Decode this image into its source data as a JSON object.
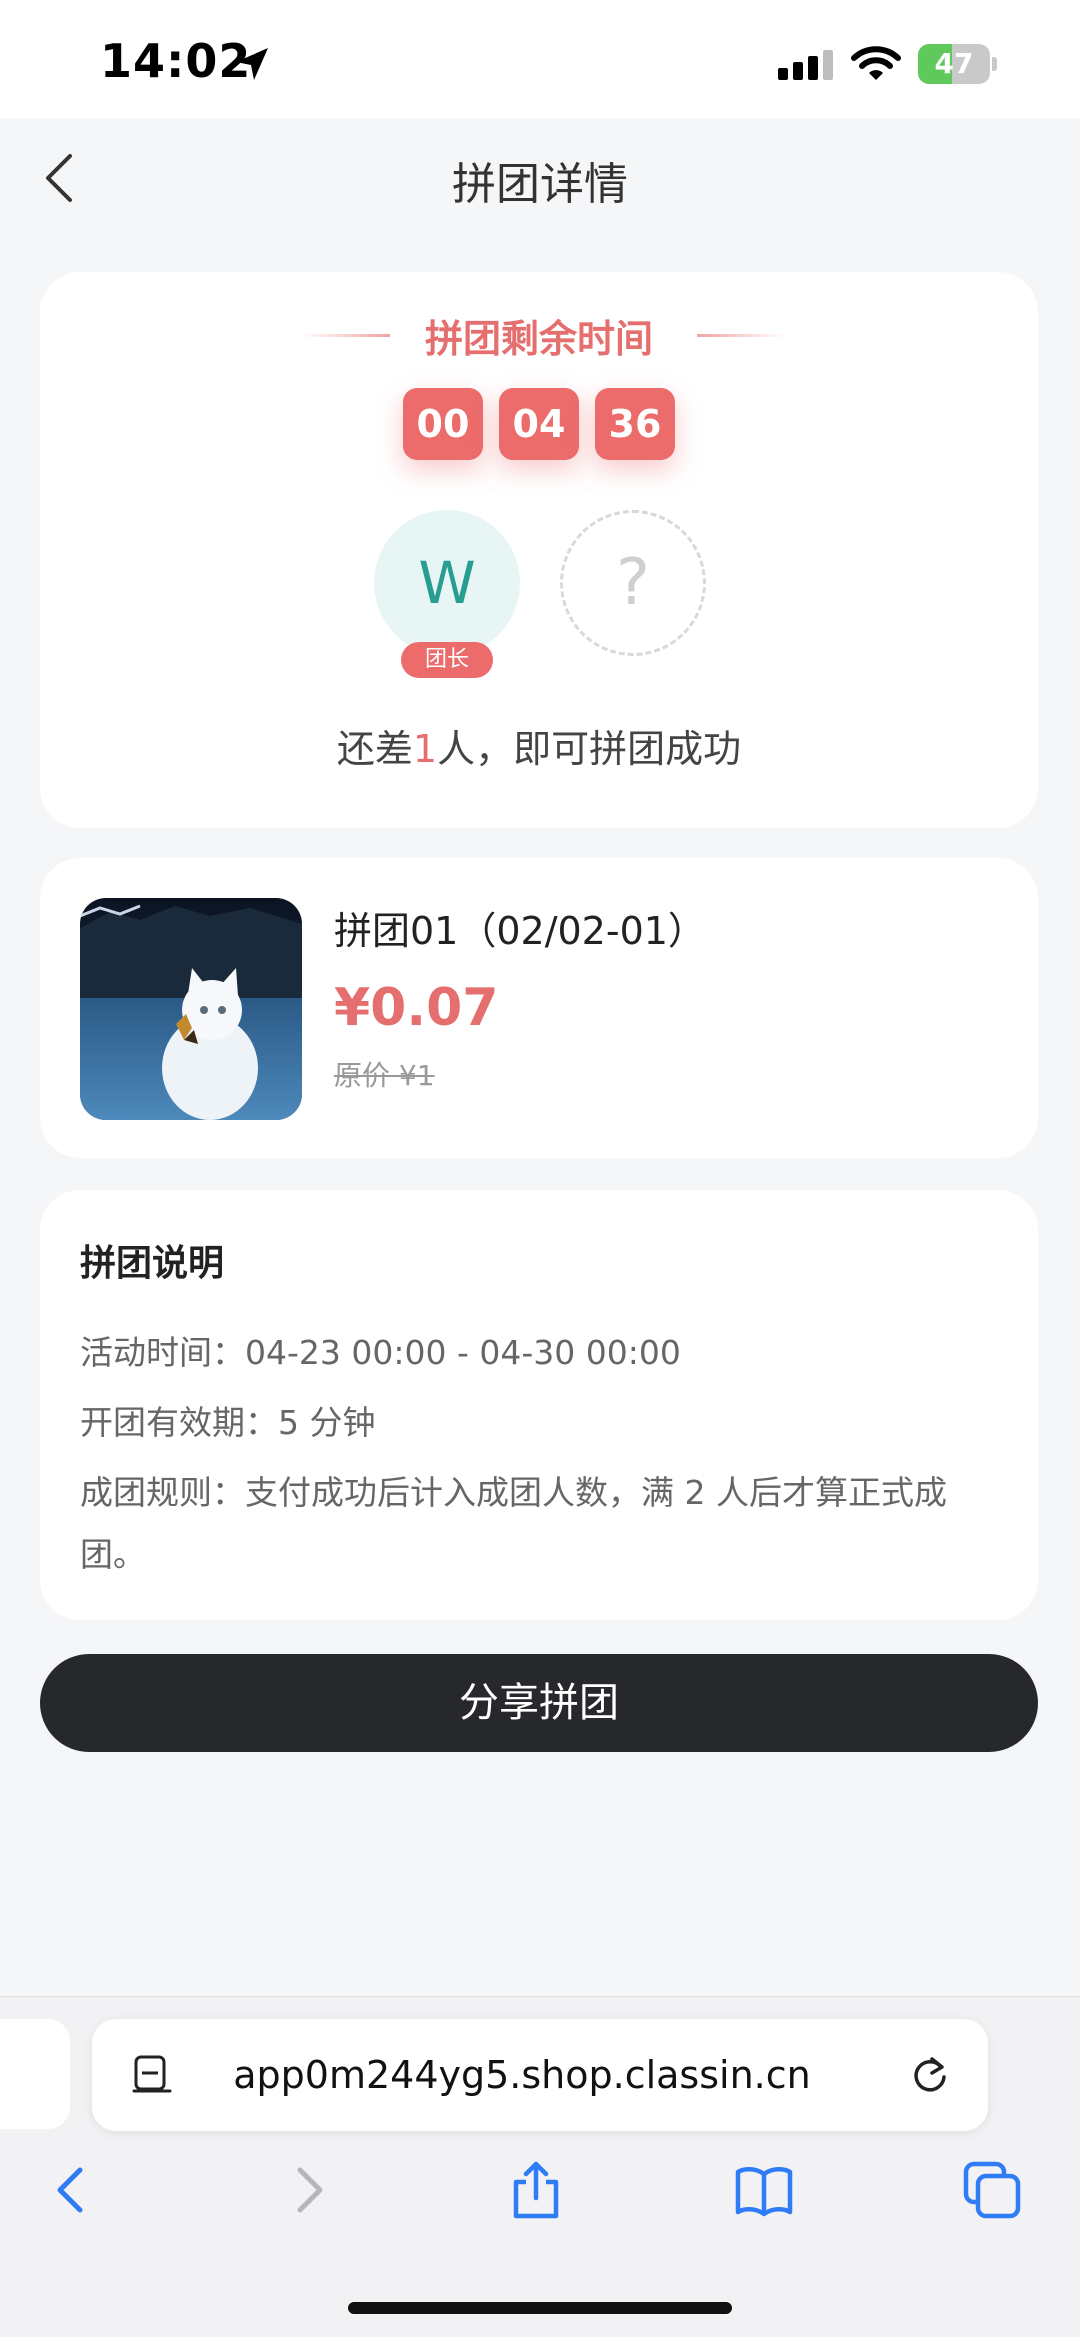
{
  "status_bar": {
    "time": "14:02",
    "battery_percent": 47,
    "battery_label": "47",
    "icons": [
      "location-arrow-icon",
      "cellular-signal-icon",
      "wifi-icon",
      "battery-charging-icon"
    ]
  },
  "nav": {
    "title": "拼团详情",
    "back_icon": "chevron-left-icon"
  },
  "countdown": {
    "title": "拼团剩余时间",
    "hours": "00",
    "minutes": "04",
    "seconds": "36",
    "leader_initial": "W",
    "leader_badge": "团长",
    "empty_slot": "?",
    "status_prefix": "还差",
    "status_count": "1",
    "status_suffix": "人，即可拼团成功"
  },
  "product": {
    "name": "拼团01（02/02-01）",
    "price": "¥0.07",
    "original_price": "原价 ¥1",
    "thumb_icon": "white-kitten-photo"
  },
  "rules": {
    "title": "拼团说明",
    "activity_time": "活动时间：04-23 00:00 - 04-30 00:00",
    "validity": "开团有效期：5 分钟",
    "group_rule": "成团规则：支付成功后计入成团人数，满 2 人后才算正式成团。"
  },
  "share_button": "分享拼团",
  "browser": {
    "url": "app0m244yg5.shop.classin.cn",
    "toolbar": [
      "back-icon",
      "forward-icon",
      "share-icon",
      "bookmarks-icon",
      "tabs-icon"
    ]
  },
  "colors": {
    "accent_red": "#e56e6e",
    "leader_teal": "#2a9d92",
    "button_dark": "#26282c",
    "browser_blue": "#2f7cf6"
  }
}
